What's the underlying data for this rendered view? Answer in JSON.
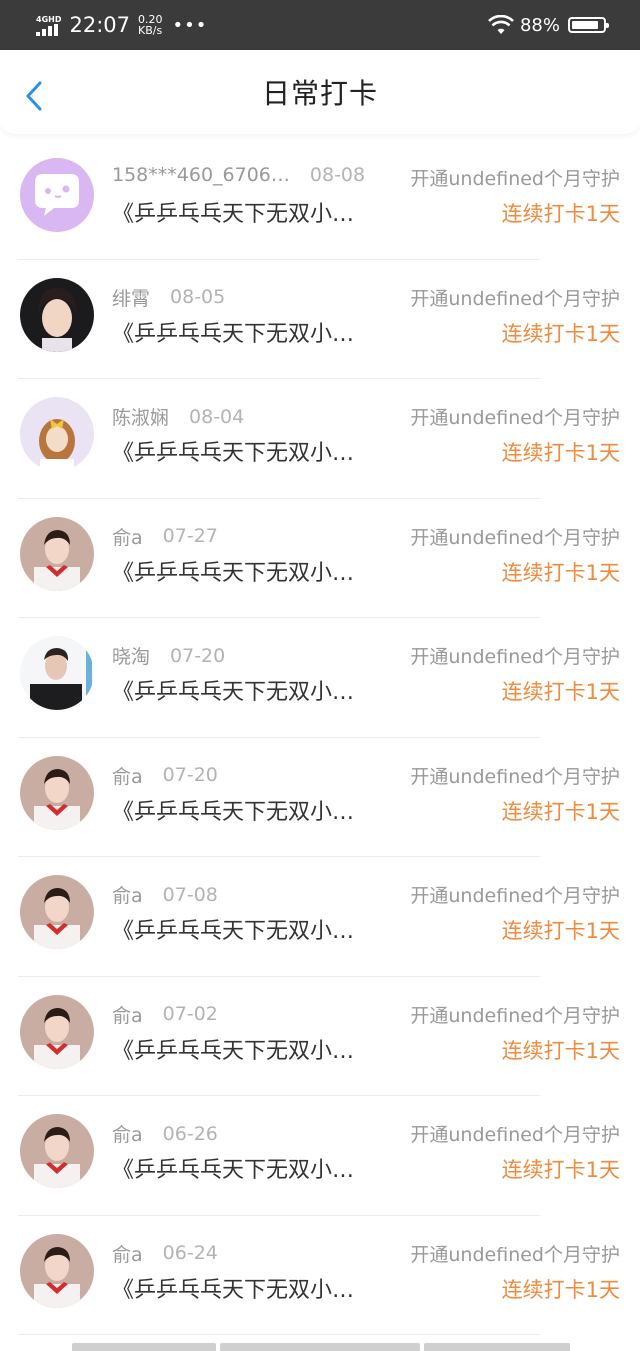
{
  "status_bar": {
    "network": "4GHD",
    "time": "22:07",
    "speed_value": "0.20",
    "speed_unit": "KB/s",
    "more": "•••",
    "battery": "88%",
    "battery_level": 0.88
  },
  "header": {
    "title": "日常打卡",
    "back_icon": "chevron-left-icon"
  },
  "colors": {
    "accent_blue": "#2b8ff0",
    "streak_orange": "#f08a3c",
    "status_bar_bg": "#3b3b3b"
  },
  "records": [
    {
      "name": "158***460_6706…",
      "date": "08-08",
      "guard": "开通undefined个月守护",
      "content": "《乒乒乓乓天下无双小…",
      "streak": "连续打卡1天",
      "avatar": "chat-bubble-avatar"
    },
    {
      "name": "绯霄",
      "date": "08-05",
      "guard": "开通undefined个月守护",
      "content": "《乒乒乓乓天下无双小…",
      "streak": "连续打卡1天",
      "avatar": "user-photo-avatar"
    },
    {
      "name": "陈淑娴",
      "date": "08-04",
      "guard": "开通undefined个月守护",
      "content": "《乒乒乓乓天下无双小…",
      "streak": "连续打卡1天",
      "avatar": "user-photo-avatar"
    },
    {
      "name": "俞a",
      "date": "07-27",
      "guard": "开通undefined个月守护",
      "content": "《乒乒乓乓天下无双小…",
      "streak": "连续打卡1天",
      "avatar": "user-photo-avatar"
    },
    {
      "name": "晓淘",
      "date": "07-20",
      "guard": "开通undefined个月守护",
      "content": "《乒乒乓乓天下无双小…",
      "streak": "连续打卡1天",
      "avatar": "user-photo-avatar"
    },
    {
      "name": "俞a",
      "date": "07-20",
      "guard": "开通undefined个月守护",
      "content": "《乒乒乓乓天下无双小…",
      "streak": "连续打卡1天",
      "avatar": "user-photo-avatar"
    },
    {
      "name": "俞a",
      "date": "07-08",
      "guard": "开通undefined个月守护",
      "content": "《乒乒乓乓天下无双小…",
      "streak": "连续打卡1天",
      "avatar": "user-photo-avatar"
    },
    {
      "name": "俞a",
      "date": "07-02",
      "guard": "开通undefined个月守护",
      "content": "《乒乒乓乓天下无双小…",
      "streak": "连续打卡1天",
      "avatar": "user-photo-avatar"
    },
    {
      "name": "俞a",
      "date": "06-26",
      "guard": "开通undefined个月守护",
      "content": "《乒乒乓乓天下无双小…",
      "streak": "连续打卡1天",
      "avatar": "user-photo-avatar"
    },
    {
      "name": "俞a",
      "date": "06-24",
      "guard": "开通undefined个月守护",
      "content": "《乒乒乓乓天下无双小…",
      "streak": "连续打卡1天",
      "avatar": "user-photo-avatar"
    }
  ]
}
